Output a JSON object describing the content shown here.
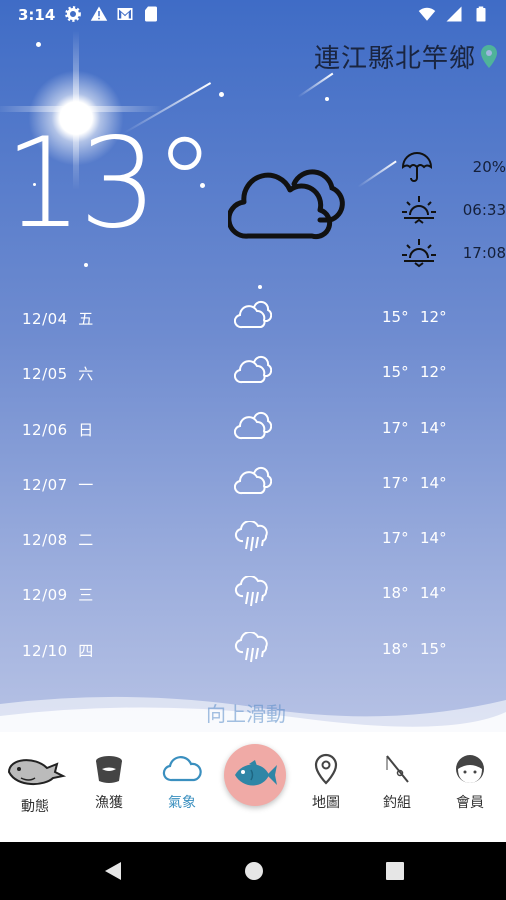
{
  "status_bar": {
    "time": "3:14",
    "left_icons": [
      "gear-icon",
      "warning-icon",
      "gmail-icon",
      "sd-card-icon"
    ],
    "right_icons": [
      "wifi-icon",
      "signal-icon",
      "battery-icon"
    ]
  },
  "location": {
    "name": "連江縣北竿鄉"
  },
  "current": {
    "temperature": "13°",
    "condition_icon": "cloud-icon",
    "rain_chance": "20%",
    "sunrise": "06:33",
    "sunset": "17:08"
  },
  "forecast": [
    {
      "date": "12/04",
      "weekday": "五",
      "icon": "cloud-icon",
      "high": "15°",
      "low": "12°"
    },
    {
      "date": "12/05",
      "weekday": "六",
      "icon": "cloud-icon",
      "high": "15°",
      "low": "12°"
    },
    {
      "date": "12/06",
      "weekday": "日",
      "icon": "cloud-icon",
      "high": "17°",
      "low": "14°"
    },
    {
      "date": "12/07",
      "weekday": "一",
      "icon": "cloud-icon",
      "high": "17°",
      "low": "14°"
    },
    {
      "date": "12/08",
      "weekday": "二",
      "icon": "rain-cloud-icon",
      "high": "17°",
      "low": "14°"
    },
    {
      "date": "12/09",
      "weekday": "三",
      "icon": "rain-cloud-icon",
      "high": "18°",
      "low": "14°"
    },
    {
      "date": "12/10",
      "weekday": "四",
      "icon": "rain-cloud-icon",
      "high": "18°",
      "low": "15°"
    }
  ],
  "swipe_hint": "向上滑動",
  "tabs": [
    {
      "label": "動態",
      "icon": "whale-icon"
    },
    {
      "label": "漁獲",
      "icon": "bucket-icon"
    },
    {
      "label": "氣象",
      "icon": "cloud-icon",
      "active": true
    },
    {
      "label": "",
      "icon": "fish-icon"
    },
    {
      "label": "地圖",
      "icon": "map-pin-icon"
    },
    {
      "label": "釣組",
      "icon": "fishing-rod-icon"
    },
    {
      "label": "會員",
      "icon": "member-face-icon"
    }
  ],
  "colors": {
    "accent": "#3a8fbf",
    "fab": "#f0aaa6",
    "pin": "#4fb39a"
  }
}
